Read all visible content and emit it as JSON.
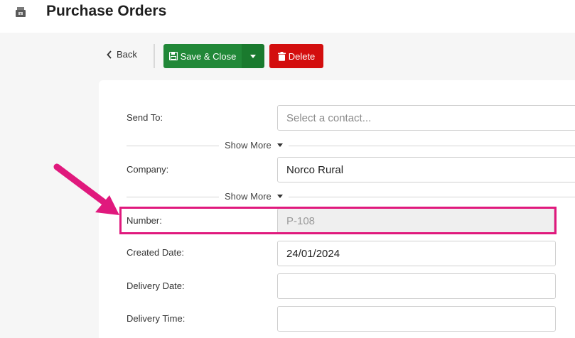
{
  "header": {
    "title": "Purchase Orders",
    "icon": "cash-register-icon"
  },
  "toolbar": {
    "back_label": "Back",
    "save_label": "Save & Close",
    "delete_label": "Delete",
    "save_color": "#218838",
    "delete_color": "#d30e0e"
  },
  "form": {
    "send_to": {
      "label": "Send To:",
      "placeholder": "Select a contact..."
    },
    "show_more_1": "Show More",
    "company": {
      "label": "Company:",
      "value": "Norco Rural"
    },
    "show_more_2": "Show More",
    "number": {
      "label": "Number:",
      "value": "P-108"
    },
    "created_date": {
      "label": "Created Date:",
      "value": "24/01/2024"
    },
    "delivery_date": {
      "label": "Delivery Date:",
      "value": ""
    },
    "delivery_time": {
      "label": "Delivery Time:",
      "value": ""
    }
  },
  "annotation": {
    "color": "#e0197d"
  }
}
